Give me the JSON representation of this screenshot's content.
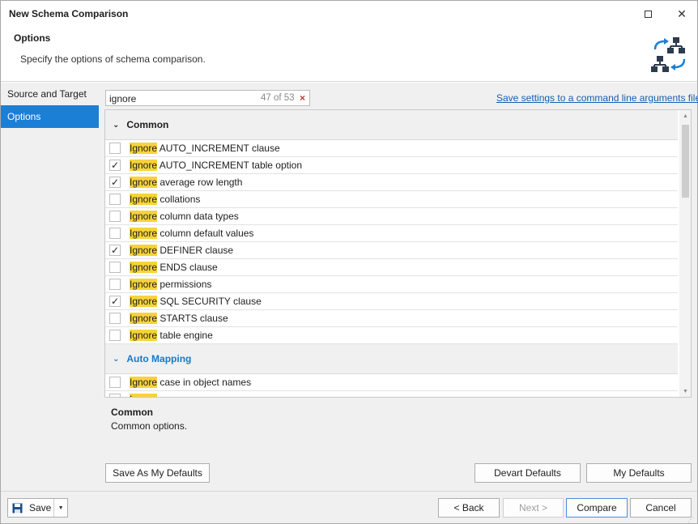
{
  "window": {
    "title": "New Schema Comparison",
    "maximize_icon": "maximize-icon",
    "close_icon": "close-icon"
  },
  "header": {
    "title": "Options",
    "description": "Specify the options of schema comparison.",
    "icon": "schema-compare-icon"
  },
  "nav": {
    "items": [
      {
        "label": "Source and Target",
        "active": false
      },
      {
        "label": "Options",
        "active": true
      }
    ]
  },
  "search": {
    "value": "ignore",
    "count": "47 of 53",
    "clear_icon": "×"
  },
  "save_settings_link": "Save settings to a command line arguments file...",
  "options": {
    "groups": [
      {
        "name": "Common",
        "items": [
          {
            "highlight": "Ignore",
            "rest": " AUTO_INCREMENT clause",
            "checked": false
          },
          {
            "highlight": "Ignore",
            "rest": " AUTO_INCREMENT table option",
            "checked": true
          },
          {
            "highlight": "Ignore",
            "rest": " average row length",
            "checked": true
          },
          {
            "highlight": "Ignore",
            "rest": " collations",
            "checked": false
          },
          {
            "highlight": "Ignore",
            "rest": " column data types",
            "checked": false
          },
          {
            "highlight": "Ignore",
            "rest": " column default values",
            "checked": false
          },
          {
            "highlight": "Ignore",
            "rest": " DEFINER clause",
            "checked": true
          },
          {
            "highlight": "Ignore",
            "rest": " ENDS clause",
            "checked": false
          },
          {
            "highlight": "Ignore",
            "rest": " permissions",
            "checked": false
          },
          {
            "highlight": "Ignore",
            "rest": " SQL SECURITY clause",
            "checked": true
          },
          {
            "highlight": "Ignore",
            "rest": " STARTS clause",
            "checked": false
          },
          {
            "highlight": "Ignore",
            "rest": " table engine",
            "checked": false
          }
        ]
      },
      {
        "name": "Auto Mapping",
        "items": [
          {
            "highlight": "Ignore",
            "rest": " case in object names",
            "checked": false
          },
          {
            "highlight": "Ignore",
            "rest": " ",
            "checked": false
          }
        ]
      }
    ]
  },
  "description": {
    "title": "Common",
    "text": "Common options."
  },
  "buttons": {
    "save_as_defaults": "Save As My Defaults",
    "devart_defaults": "Devart Defaults",
    "my_defaults": "My Defaults"
  },
  "footer": {
    "save": "Save",
    "back": "< Back",
    "next": "Next >",
    "compare": "Compare",
    "cancel": "Cancel"
  },
  "colors": {
    "accent": "#1c7fd6",
    "highlight": "#f7d33a",
    "link": "#1060b0"
  }
}
